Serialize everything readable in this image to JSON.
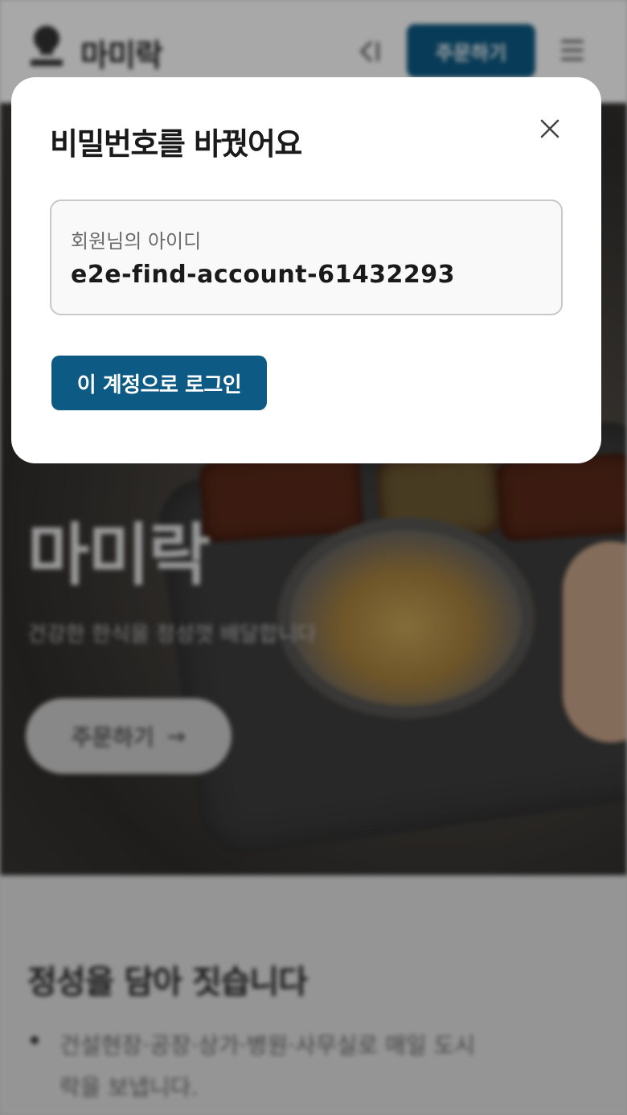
{
  "header": {
    "brand": "마미락",
    "order_label": "주문하기",
    "brand_color": "#0d5a84"
  },
  "hero": {
    "title": "마미락",
    "subtitle": "건강한 한식을 정성껏 배달합니다",
    "cta_label": "주문하기",
    "cta_arrow": "→"
  },
  "section": {
    "title": "정성을 담아 짓습니다",
    "bullet_text": "건설현장·공장·상가·병원·사무실로 매일 도시락을 보냅니다."
  },
  "modal": {
    "title": "비밀번호를 바꿨어요",
    "close_icon": "close-icon",
    "id_label": "회원님의 아이디",
    "id_value": "e2e-find-account-61432293",
    "login_button": "이 계정으로 로그인"
  }
}
